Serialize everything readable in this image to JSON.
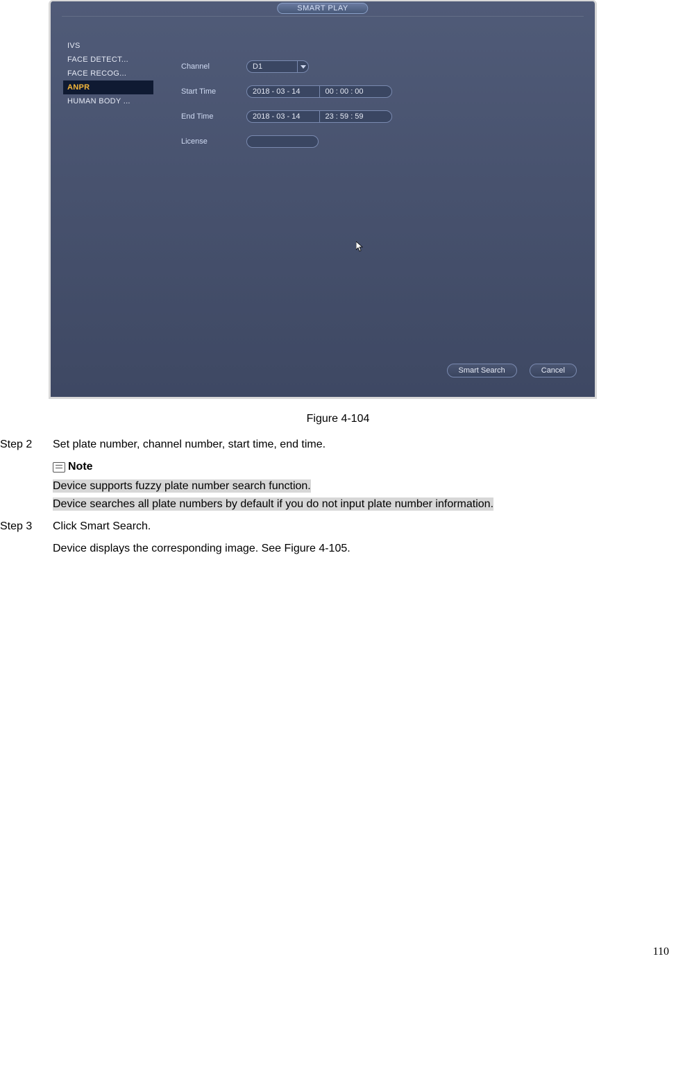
{
  "screenshot": {
    "title": "SMART PLAY",
    "sidebar": {
      "items": [
        {
          "label": "IVS",
          "selected": false
        },
        {
          "label": "FACE DETECT...",
          "selected": false
        },
        {
          "label": "FACE RECOG...",
          "selected": false
        },
        {
          "label": "ANPR",
          "selected": true
        },
        {
          "label": "HUMAN BODY ...",
          "selected": false
        }
      ]
    },
    "form": {
      "channel_label": "Channel",
      "channel_value": "D1",
      "start_time_label": "Start Time",
      "start_date": "2018  - 03 - 14",
      "start_time": "00 : 00  : 00",
      "end_time_label": "End Time",
      "end_date": "2018  - 03 - 14",
      "end_time": "23 : 59  : 59",
      "license_label": "License",
      "license_value": ""
    },
    "buttons": {
      "search": "Smart Search",
      "cancel": "Cancel"
    }
  },
  "doc": {
    "figure_caption": "Figure 4-104",
    "step2_label": "Step 2",
    "step2_text": "Set plate number, channel number, start time, end time.",
    "note_label": "Note",
    "note_line1": "Device supports fuzzy plate number search function.",
    "note_line2": "Device searches all plate numbers by default if you do not input plate number information.",
    "step3_label": "Step 3",
    "step3_text": "Click Smart Search.",
    "step3_sub": "Device displays the corresponding image. See Figure 4-105.",
    "page_number": "110"
  }
}
